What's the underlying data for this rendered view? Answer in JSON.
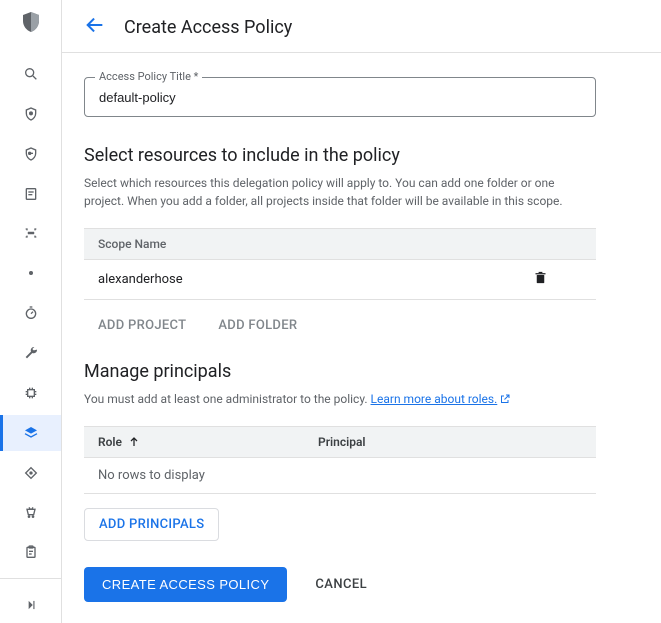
{
  "header": {
    "title": "Create Access Policy"
  },
  "form": {
    "title_label": "Access Policy Title *",
    "title_value": "default-policy"
  },
  "resources": {
    "heading": "Select resources to include in the policy",
    "description": "Select which resources this delegation policy will apply to. You can add one folder or one project. When you add a folder, all projects inside that folder will be available in this scope.",
    "column_name": "Scope Name",
    "rows": [
      {
        "name": "alexanderhose"
      }
    ],
    "add_project_label": "ADD PROJECT",
    "add_folder_label": "ADD FOLDER"
  },
  "principals": {
    "heading": "Manage principals",
    "description_pre": "You must add at least one administrator to the policy. ",
    "link_text": "Learn more about roles.",
    "col_role": "Role",
    "col_principal": "Principal",
    "empty_text": "No rows to display",
    "add_button": "ADD PRINCIPALS"
  },
  "footer": {
    "create_label": "CREATE ACCESS POLICY",
    "cancel_label": "CANCEL"
  }
}
